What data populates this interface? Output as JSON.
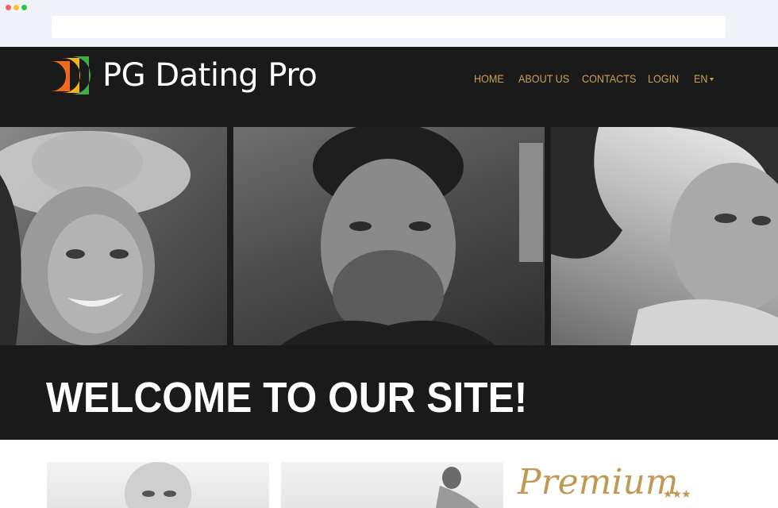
{
  "browser": {
    "url_value": ""
  },
  "header": {
    "logo_text": "PG Dating Pro",
    "nav": {
      "home": "HOME",
      "about": "ABOUT US",
      "contacts": "CONTACTS",
      "login": "LOGIN",
      "language": "EN"
    }
  },
  "hero": {
    "welcome": "WELCOME TO OUR SITE!"
  },
  "featured": {
    "premium_label": "Premium",
    "stars": "★★★"
  },
  "colors": {
    "accent": "#c9a15b",
    "header_bg": "#1a1a1a",
    "chrome_bg": "#f0f3f7"
  }
}
